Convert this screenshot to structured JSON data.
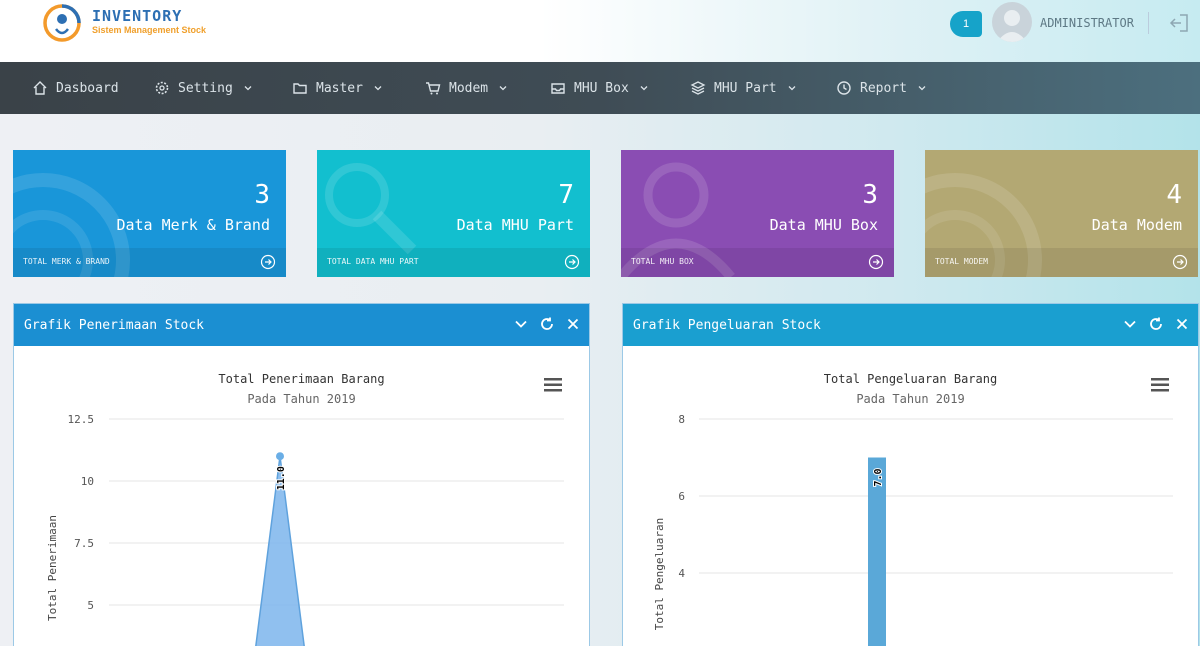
{
  "header": {
    "brand_name": "INVENTORY",
    "brand_sub": "Sistem Management Stock",
    "notification_count": "1",
    "username": "ADMINISTRATOR"
  },
  "nav": [
    {
      "label": "Dasboard",
      "icon": "home-icon",
      "dropdown": false
    },
    {
      "label": "Setting",
      "icon": "gear-icon",
      "dropdown": true
    },
    {
      "label": "Master",
      "icon": "folder-icon",
      "dropdown": true
    },
    {
      "label": "Modem",
      "icon": "cart-icon",
      "dropdown": true
    },
    {
      "label": "MHU Box",
      "icon": "inbox-icon",
      "dropdown": true
    },
    {
      "label": "MHU Part",
      "icon": "layers-icon",
      "dropdown": true
    },
    {
      "label": "Report",
      "icon": "clock-icon",
      "dropdown": true
    }
  ],
  "cards": [
    {
      "count": "3",
      "title": "Data Merk & Brand",
      "footer": "TOTAL MERK & BRAND",
      "color": "#1996d9"
    },
    {
      "count": "7",
      "title": "Data MHU Part",
      "footer": "TOTAL DATA MHU PART",
      "color": "#12bfcf"
    },
    {
      "count": "3",
      "title": "Data MHU Box",
      "footer": "TOTAL MHU BOX",
      "color": "#8a4db3"
    },
    {
      "count": "4",
      "title": "Data Modem",
      "footer": "TOTAL MODEM",
      "color": "#b3a873"
    }
  ],
  "panels": [
    {
      "title": "Grafik Penerimaan Stock",
      "chart_title": "Total Penerimaan Barang",
      "chart_sub": "Pada Tahun 2019",
      "head_color": "#1b8fd2"
    },
    {
      "title": "Grafik Pengeluaran Stock",
      "chart_title": "Total Pengeluaran Barang",
      "chart_sub": "Pada Tahun 2019",
      "head_color": "#1a9fd0"
    }
  ],
  "chart_data": [
    {
      "type": "area",
      "title": "Total Penerimaan Barang",
      "subtitle": "Pada Tahun 2019",
      "ylabel": "Total Penerimaan",
      "yticks": [
        "12.5",
        "10",
        "7.5",
        "5"
      ],
      "ylim": [
        5,
        12.5
      ],
      "series": [
        {
          "values": [
            11.0
          ]
        }
      ],
      "data_labels": [
        "11.0"
      ]
    },
    {
      "type": "bar",
      "title": "Total Pengeluaran Barang",
      "subtitle": "Pada Tahun 2019",
      "ylabel": "Total Pengeluaran",
      "yticks": [
        "8",
        "6",
        "4"
      ],
      "ylim": [
        4,
        8
      ],
      "series": [
        {
          "values": [
            7.0
          ]
        }
      ],
      "data_labels": [
        "7.0"
      ]
    }
  ]
}
